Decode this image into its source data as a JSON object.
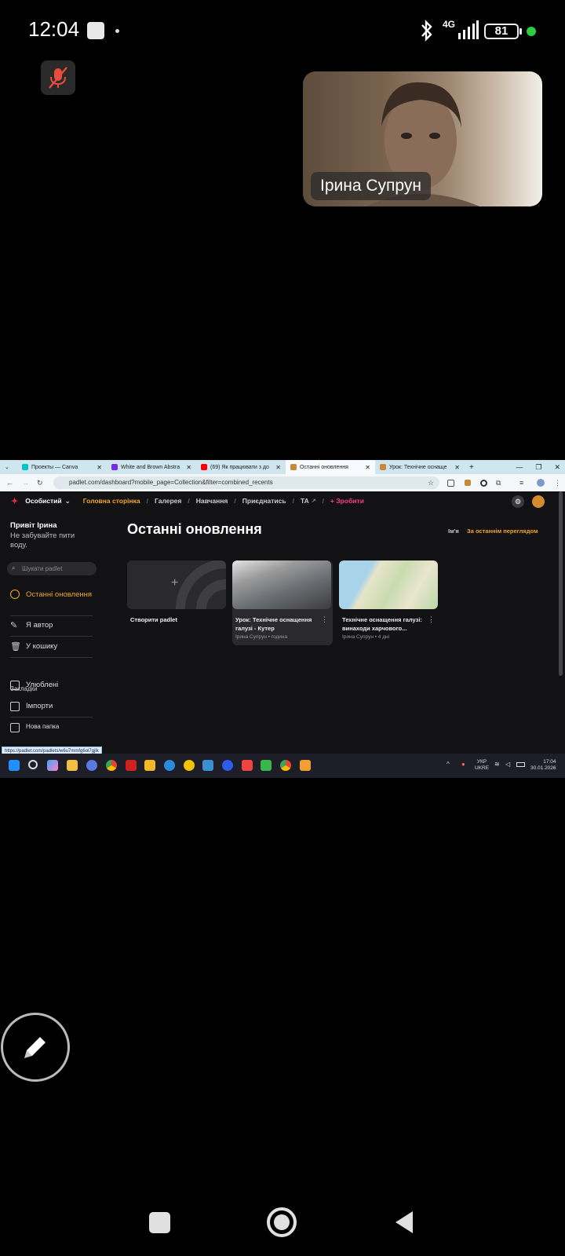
{
  "status_bar": {
    "time": "12:04",
    "network": "4G",
    "battery": "81"
  },
  "video": {
    "participant_name": "Ірина Супрун"
  },
  "browser": {
    "tabs": [
      {
        "label": "Проекты — Canva",
        "color": "#00c4cc"
      },
      {
        "label": "White and Brown Abstra",
        "color": "#7d2ae8"
      },
      {
        "label": "(69) Як працювати з до",
        "color": "#ff0000"
      },
      {
        "label": "Останні оновлення",
        "color": "#c88a3a"
      },
      {
        "label": "Урок: Технічне оснаще",
        "color": "#c88a3a"
      }
    ],
    "url": "padlet.com/dashboard?mobile_page=Collection&filter=combined_recents",
    "link_hover": "https://padlet.com/padlets/w6u7mmfg6ol7gjlk"
  },
  "padlet": {
    "workspace": "Особистий",
    "nav": [
      "Головна сторінка",
      "Галерея",
      "Навчання",
      "Приєднатись",
      "ТА",
      "+ Зробити"
    ],
    "greeting": "Привіт Ірина",
    "reminder": "Не забувайте пити воду.",
    "search_placeholder": "Шукати padlet",
    "sidebar": {
      "recent": "Останні оновлення",
      "author": "Я автор",
      "trash": "У кошику",
      "bookmarks_label": "Закладки",
      "favorites": "Улюблені",
      "imports": "Імпорти",
      "new_folder": "Нова папка"
    },
    "page_title": "Останні оновлення",
    "sort": {
      "name": "Ім'я",
      "recent": "За останнім переглядом"
    },
    "cards": [
      {
        "title": "Створити padlet",
        "meta": ""
      },
      {
        "title": "Урок: Технічне оснащення галузі - Кутер",
        "meta": "Ірина Супрун • година"
      },
      {
        "title": "Технічне оснащення галузі: винаходи харчового...",
        "meta": "Ірина Супрун • 4 дні"
      }
    ]
  },
  "taskbar": {
    "lang": "УКР",
    "lang_sub": "UKRE",
    "time": "17:04",
    "date": "30.01.2026"
  }
}
